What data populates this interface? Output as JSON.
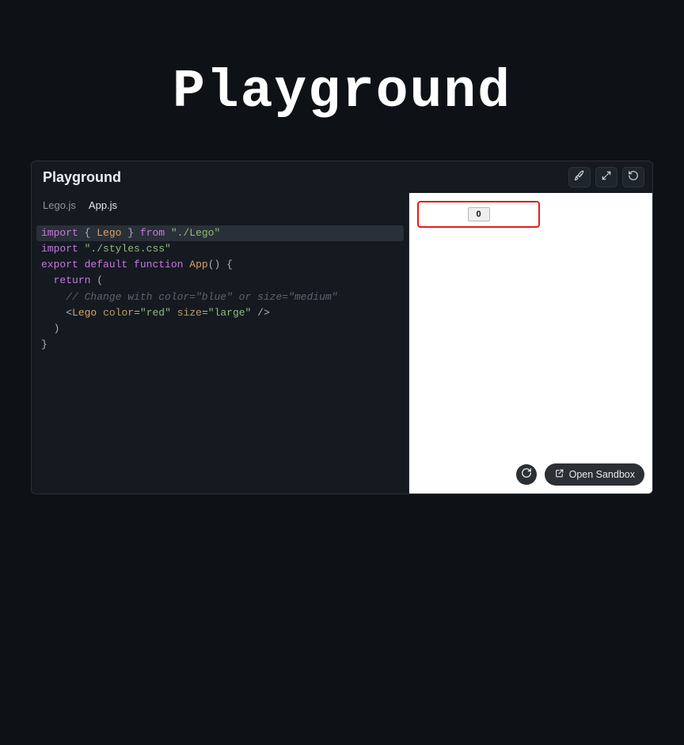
{
  "page_title": "Playground",
  "panel": {
    "title": "Playground",
    "actions": {
      "rocket": "rocket-icon",
      "expand": "expand-icon",
      "refresh": "refresh-icon"
    }
  },
  "tabs": [
    {
      "label": "Lego.js",
      "active": false
    },
    {
      "label": "App.js",
      "active": true
    }
  ],
  "code": {
    "line1": {
      "kw1": "import",
      "brace_open": " { ",
      "id": "Lego",
      "brace_close": " } ",
      "kw2": "from",
      "sp": " ",
      "str": "\"./Lego\""
    },
    "line2": {
      "kw": "import",
      "sp": " ",
      "str": "\"./styles.css\""
    },
    "line3": "",
    "line4": {
      "kw1": "export",
      "sp1": " ",
      "kw2": "default",
      "sp2": " ",
      "kw3": "function",
      "sp3": " ",
      "fn": "App",
      "rest": "() {"
    },
    "line5": {
      "indent": "  ",
      "kw": "return",
      "rest": " ("
    },
    "line6": {
      "indent": "    ",
      "cmt": "// Change with color=\"blue\" or size=\"medium\""
    },
    "line7": {
      "indent": "    ",
      "open": "<",
      "comp": "Lego",
      "sp1": " ",
      "attr1": "color",
      "eq1": "=",
      "val1": "\"red\"",
      "sp2": " ",
      "attr2": "size",
      "eq2": "=",
      "val2": "\"large\"",
      "close": " />"
    },
    "line8": {
      "indent": "  ",
      "text": ")"
    },
    "line9": {
      "text": "}"
    }
  },
  "preview": {
    "button_label": "0",
    "open_sandbox_label": "Open Sandbox"
  }
}
